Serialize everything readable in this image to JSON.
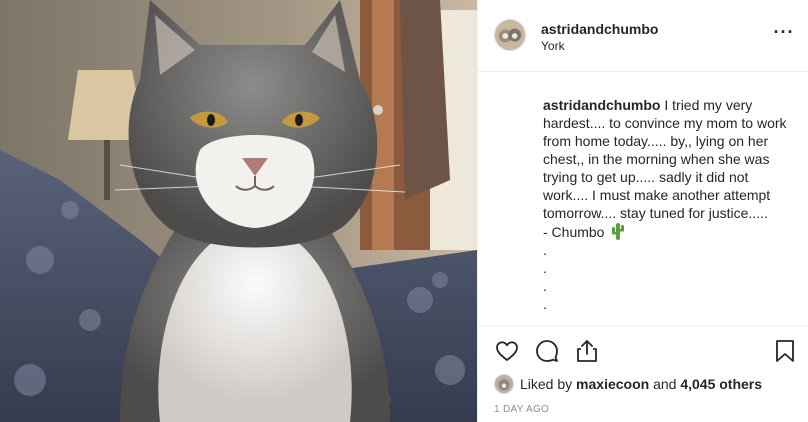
{
  "post": {
    "username": "astridandchumbo",
    "location": "York",
    "more_icon": "ellipsis-icon",
    "caption": {
      "username": "astridandchumbo",
      "lines": [
        "I tried my very",
        "hardest.... to convince my mom to work",
        "from home today..... by,, lying on her",
        "chest,, in the morning when she was",
        "trying to get up..... sadly it did not",
        "work.... I must make another attempt",
        "tomorrow.... stay tuned for justice.....",
        "- Chumbo",
        ".",
        ".",
        ".",
        "."
      ],
      "emoji": "cactus-icon"
    },
    "actions": {
      "like_icon": "heart-icon",
      "comment_icon": "comment-icon",
      "share_icon": "share-icon",
      "save_icon": "bookmark-icon"
    },
    "likes": {
      "prefix": "Liked by",
      "user": "maxiecoon",
      "middle": "and",
      "count": "4,045 others"
    },
    "timestamp": "1 DAY AGO"
  },
  "photo": {
    "subject": "grey and white long-haired cat on a bed"
  },
  "colors": {
    "text": "#262626",
    "muted": "#8e8e8e",
    "divider": "#efefef",
    "cactus": "#5c9e3a"
  }
}
